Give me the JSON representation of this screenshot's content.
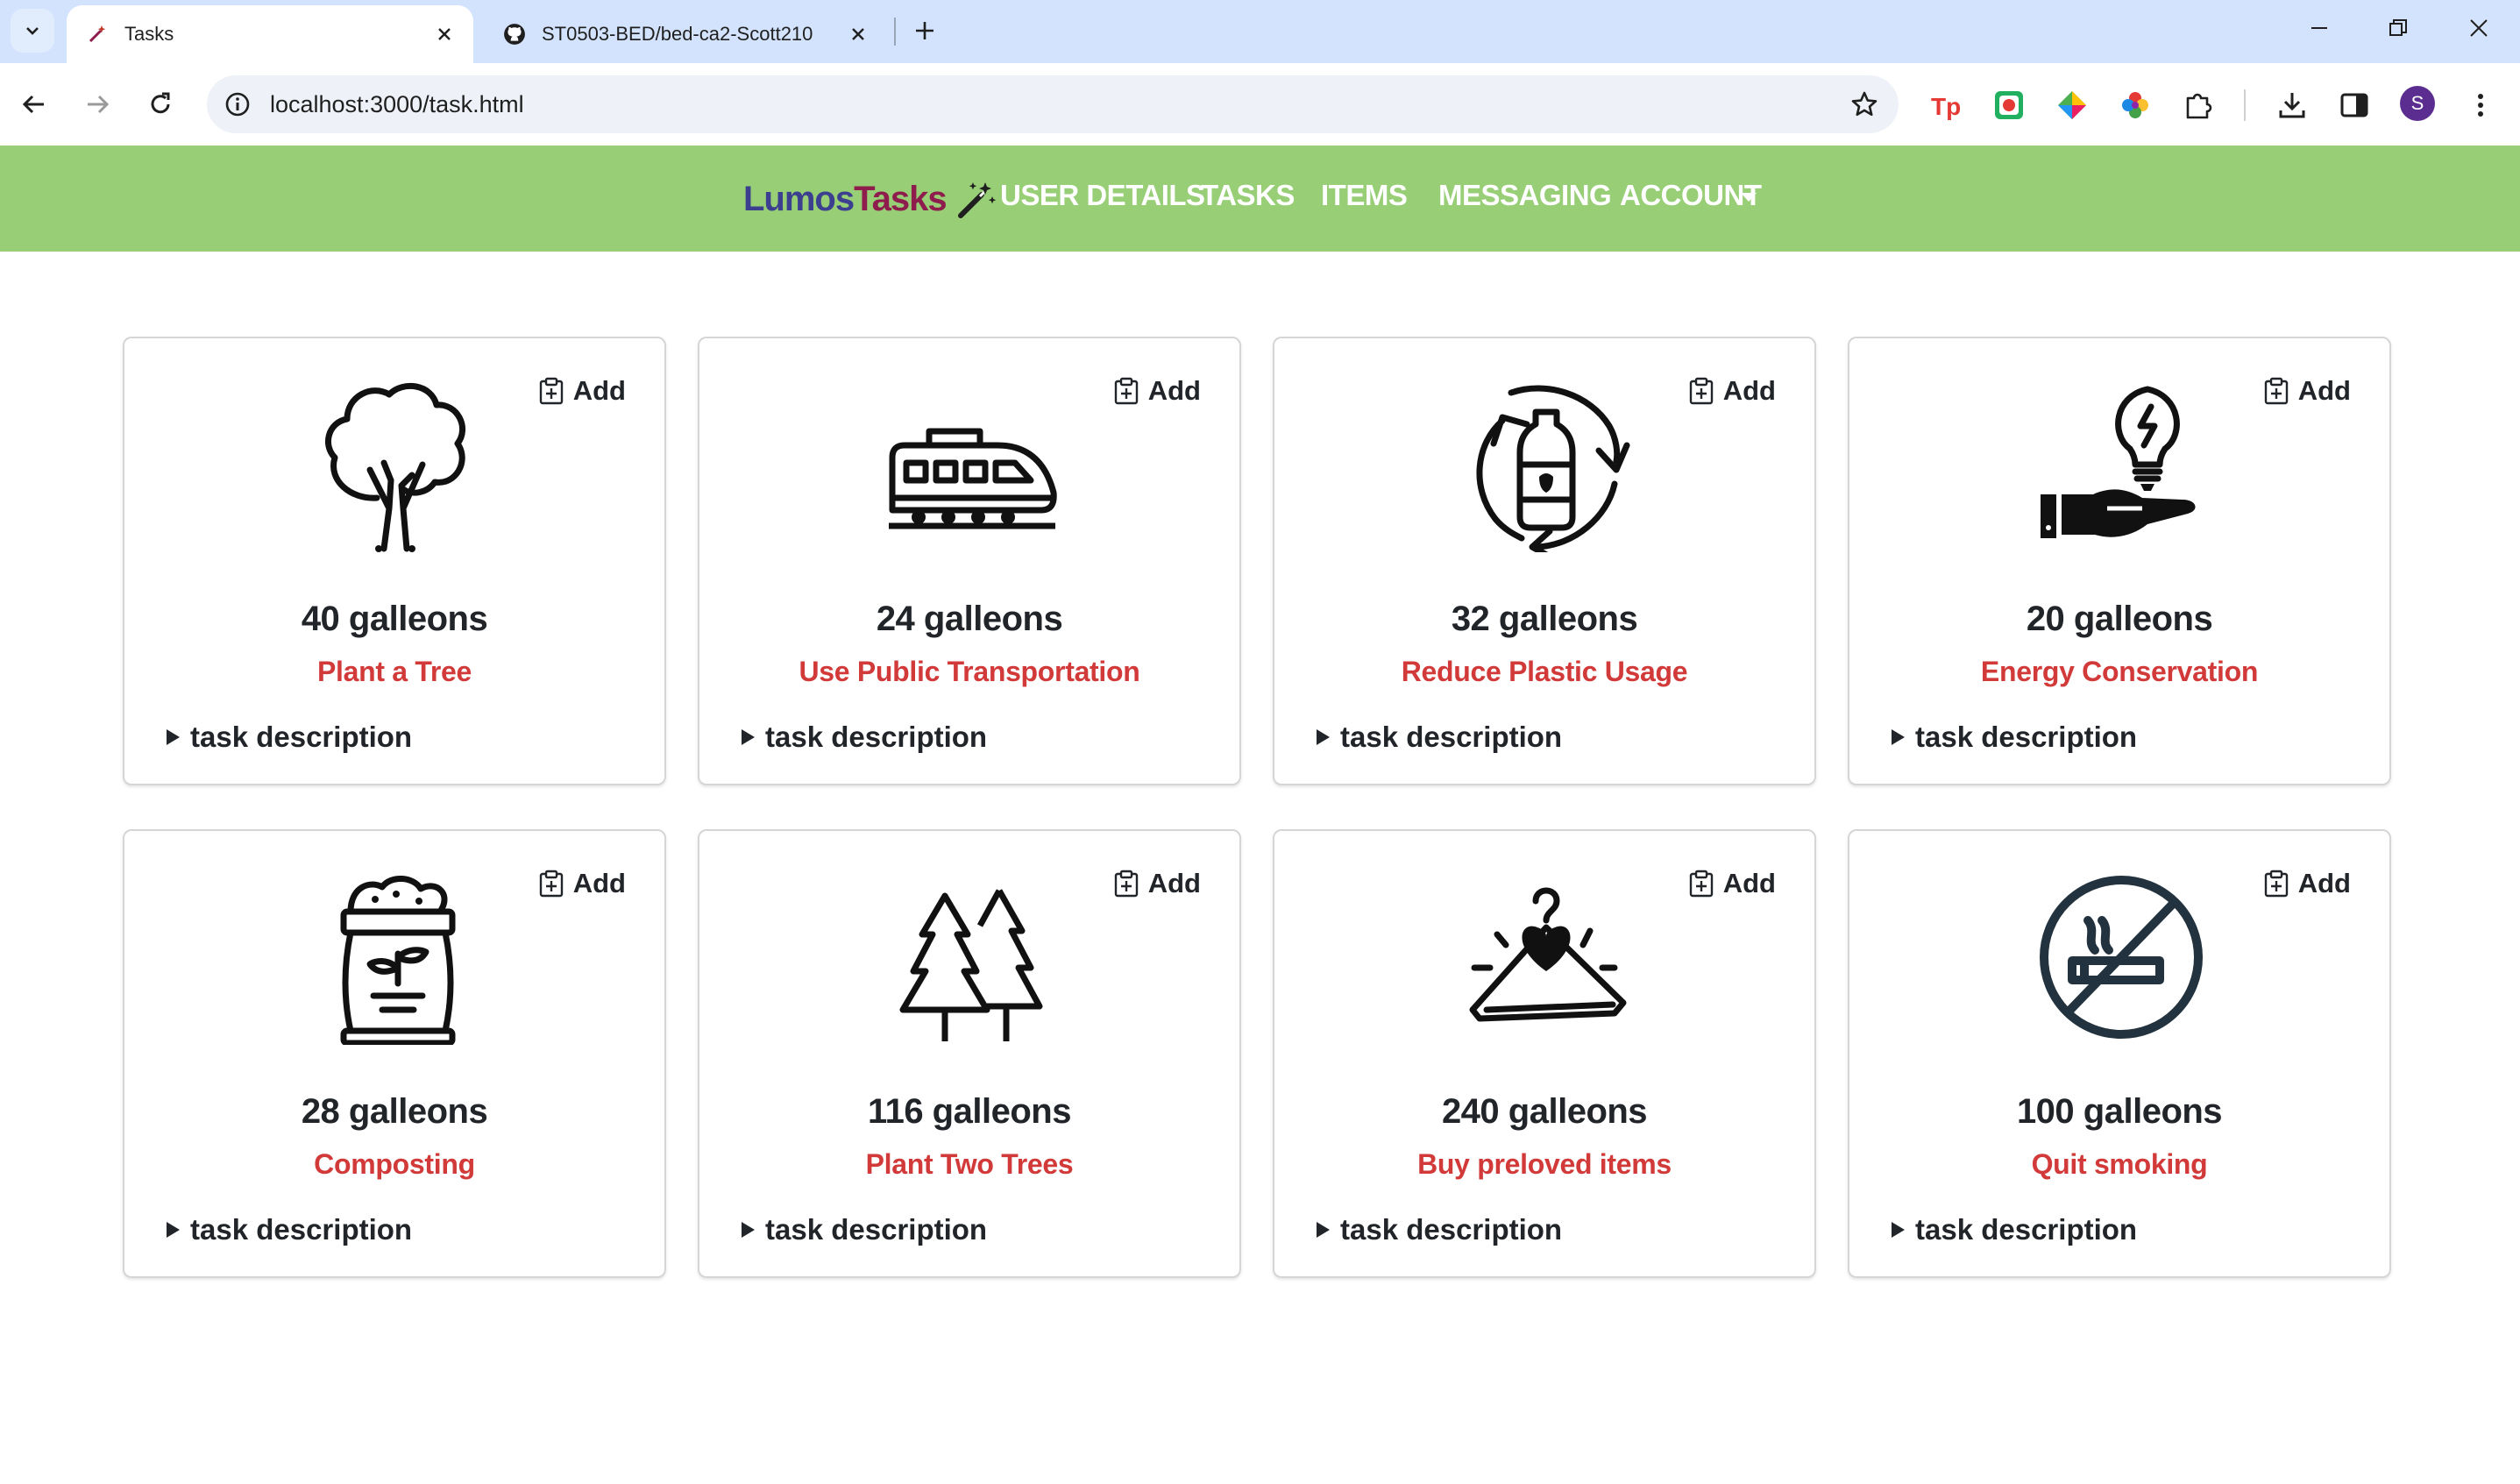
{
  "browser": {
    "tabs": [
      {
        "title": "Tasks",
        "active": true
      },
      {
        "title": "ST0503-BED/bed-ca2-Scott210",
        "active": false
      }
    ],
    "url": "localhost:3000/task.html",
    "profile_initial": "S"
  },
  "navbar": {
    "brand_part1": "Lumos",
    "brand_part2": "Tasks",
    "links": [
      "USER DETAILS",
      "TASKS",
      "ITEMS",
      "MESSAGING",
      "ACCOUNT"
    ]
  },
  "colors": {
    "navbar_bg": "#97ce76",
    "task_name": "#d23a3a",
    "brand_lumos": "#3c3f8f",
    "brand_tasks": "#8e1d4d"
  },
  "add_label": "Add",
  "description_label": "task description",
  "tasks": [
    {
      "points": "40 galleons",
      "name": "Plant a Tree",
      "icon": "tree-icon"
    },
    {
      "points": "24 galleons",
      "name": "Use Public Transportation",
      "icon": "train-icon"
    },
    {
      "points": "32 galleons",
      "name": "Reduce Plastic Usage",
      "icon": "recycle-bottle-icon"
    },
    {
      "points": "20 galleons",
      "name": "Energy Conservation",
      "icon": "hand-lightbulb-icon"
    },
    {
      "points": "28 galleons",
      "name": "Composting",
      "icon": "compost-bag-icon"
    },
    {
      "points": "116 galleons",
      "name": "Plant Two Trees",
      "icon": "two-pine-trees-icon"
    },
    {
      "points": "240 galleons",
      "name": "Buy preloved items",
      "icon": "hanger-heart-icon"
    },
    {
      "points": "100 galleons",
      "name": "Quit smoking",
      "icon": "no-smoking-icon"
    }
  ]
}
